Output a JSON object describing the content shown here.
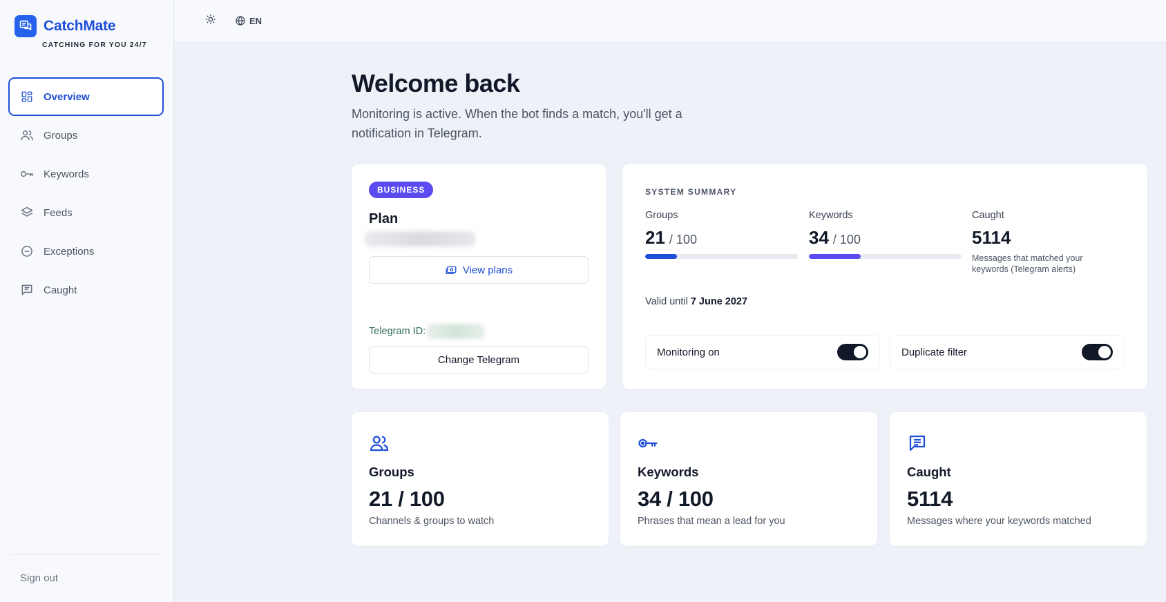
{
  "brand": {
    "name": "CatchMate",
    "tagline": "CATCHING FOR YOU 24/7"
  },
  "sidebar": {
    "items": [
      {
        "label": "Overview",
        "icon": "dashboard-icon",
        "active": true
      },
      {
        "label": "Groups",
        "icon": "users-icon",
        "active": false
      },
      {
        "label": "Keywords",
        "icon": "key-icon",
        "active": false
      },
      {
        "label": "Feeds",
        "icon": "layers-icon",
        "active": false
      },
      {
        "label": "Exceptions",
        "icon": "minus-circle-icon",
        "active": false
      },
      {
        "label": "Caught",
        "icon": "message-icon",
        "active": false
      }
    ],
    "signout_label": "Sign out"
  },
  "topbar": {
    "theme_icon": "sun-icon",
    "language": "EN"
  },
  "welcome": {
    "title": "Welcome back",
    "subtitle": "Monitoring is active. When the bot finds a match, you'll get a notification in Telegram."
  },
  "plan": {
    "badge": "BUSINESS",
    "title": "Plan",
    "view_plans_label": "View plans",
    "telegram_label": "Telegram ID:",
    "change_telegram_label": "Change Telegram"
  },
  "summary": {
    "heading": "SYSTEM SUMMARY",
    "groups": {
      "label": "Groups",
      "value": "21",
      "limit": "/ 100",
      "fraction": 0.21
    },
    "keywords": {
      "label": "Keywords",
      "value": "34",
      "limit": "/ 100",
      "fraction": 0.34
    },
    "caught": {
      "label": "Caught",
      "value": "5114",
      "desc": "Messages that matched your keywords (Telegram alerts)"
    },
    "valid_prefix": "Valid until",
    "valid_date": "7 June 2027",
    "monitoring_label": "Monitoring on",
    "monitoring_on": true,
    "duplicate_label": "Duplicate filter",
    "duplicate_on": true
  },
  "cards": [
    {
      "icon": "users-icon",
      "title": "Groups",
      "value": "21 / 100",
      "desc": "Channels & groups to watch"
    },
    {
      "icon": "key-icon",
      "title": "Keywords",
      "value": "34 / 100",
      "desc": "Phrases that mean a lead for you"
    },
    {
      "icon": "message-icon",
      "title": "Caught",
      "value": "5114",
      "desc": "Messages where your keywords matched"
    }
  ],
  "colors": {
    "accent": "#1d4ed8",
    "badge": "#5b4bf0",
    "keywords_bar": "#5b4bf0",
    "groups_bar": "#1d4ed8",
    "toggle": "#111827"
  }
}
